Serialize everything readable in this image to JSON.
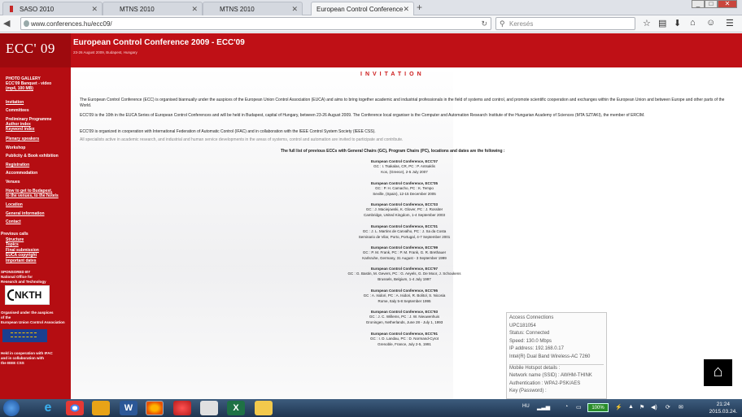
{
  "browser": {
    "tabs": [
      {
        "label": "SASO 2010",
        "active": false
      },
      {
        "label": "MTNS 2010",
        "active": false
      },
      {
        "label": "MTNS 2010",
        "active": false
      },
      {
        "label": "European Control Conference",
        "active": true
      }
    ],
    "url": "www.conferences.hu/ecc09/",
    "search_placeholder": "Keresés",
    "window_buttons": [
      "_",
      "□",
      "✕"
    ]
  },
  "site": {
    "logo": "ECC' 09",
    "title": "European Control Conference 2009 - ECC'09",
    "subtitle": "23-26 August 2009, Budapest, Hungary"
  },
  "sidebar": {
    "items": [
      {
        "label": "PHOTO GALLERY",
        "link": false
      },
      {
        "label": "ECC'09 Banquet - video",
        "link": false
      },
      {
        "label": "(mp4, 100 MB)",
        "link": false
      },
      {
        "label": "Invitation",
        "link": true
      },
      {
        "label": "Committees",
        "link": false
      },
      {
        "label": "Preliminary Programme",
        "link": false
      },
      {
        "label": "Author index",
        "link": true
      },
      {
        "label": "Keyword index",
        "link": true
      },
      {
        "label": "Plenary speakers",
        "link": true
      },
      {
        "label": "Workshop",
        "link": false
      },
      {
        "label": "Publicity & Book exhibition",
        "link": false
      },
      {
        "label": "Registration",
        "link": true
      },
      {
        "label": "Accommodation",
        "link": false
      },
      {
        "label": "Venues",
        "link": false
      },
      {
        "label": "How to get to Budapest,",
        "link": true
      },
      {
        "label": "to the venues, to the hotels",
        "link": true
      },
      {
        "label": "Location",
        "link": true
      },
      {
        "label": "General information",
        "link": true
      },
      {
        "label": "Contact",
        "link": true
      },
      {
        "label": "Previous calls",
        "link": false
      },
      {
        "label": "Structure",
        "link": true
      },
      {
        "label": "Topics",
        "link": true
      },
      {
        "label": "Final submission",
        "link": true
      },
      {
        "label": "EUCA copyright",
        "link": true
      },
      {
        "label": "Important dates",
        "link": true
      }
    ],
    "sponsor_text": [
      "SPONSORED BY",
      "National Office for",
      "Research and Technology"
    ],
    "nkth_logo": "NKTH",
    "organised_text": [
      "Organised under the auspices",
      "of the",
      "European Union Control Association"
    ],
    "held_text": [
      "Held in cooperation with IFAC",
      "and in collaboration with",
      "the IEEE CSS"
    ]
  },
  "main": {
    "heading": "INVITATION",
    "para1": "The European Control Conference (ECC) is organised biannually under the auspices of the European Union Control Association (EUCA) and aims to bring together academic and industrial professionals in the field of systems and control, and promote scientific cooperation and exchanges within the European Union and between Europe and other parts of the World.",
    "para2": "ECC'09 is the 10th in the EUCA Series of European Control Conferences and will be held in Budapest, capital of Hungary, between 23-26 August 2009. The Conference local organiser is the Computer and Automation Research Institute of the Hungarian Academy of Sciences (MTA SZTAKI), the member of ERCIM.",
    "para3": "ECC'09 is organized in cooperation with International Federation of Automatic Control (IFAC) and in collaboration with the IEEE Control System Society (IEEE CSS).",
    "para4": "All specialists active in academic research, and industrial and human service developments in the areas of systems, control and automation are invited to participate and contribute.",
    "full_list": "The full list of previous ECCs with General Chairs (GC), Program Chairs (PC), locations and dates are the following :",
    "previous": [
      {
        "name": "European Control Conference, ECC'07",
        "chairs": "GC : I. Tsakalas, CR, PC : P. Antsaklis",
        "place": "Kos, (Greece), 2-5 July 2007"
      },
      {
        "name": "European Control Conference, ECC'05",
        "chairs": "GC : P. H. Camacho, PC : K. Tempo",
        "place": "Seville, (Spain), 12-15 December 2005"
      },
      {
        "name": "European Control Conference, ECC'03",
        "chairs": "GC : J. Maciejowski, K. Glover, PC : J. Rossiter",
        "place": "Cambridge, United Kingdom, 1-4 September 2003"
      },
      {
        "name": "European Control Conference, ECC'01",
        "chairs": "GC : J. L. Martins de Carvalho, PC : J. Sa da Costa",
        "place": "Seminario de Vilar, Porto, Portugal, 4-7 September 2001"
      },
      {
        "name": "European Control Conference, ECC'99",
        "chairs": "GC : P. M. Frank, PC : P. M. Frank, G. R. Brethauer",
        "place": "Karlsruhe, Germany, 31 August - 3 September 1999"
      },
      {
        "name": "European Control Conference, ECC'97",
        "chairs": "GC : G. Bastin, M. Gevers, PC : G. Aeyels, G. De Moor, J. Schoukens",
        "place": "Brussels, Belgium, 1-4 July 1997"
      },
      {
        "name": "European Control Conference, ECC'95",
        "chairs": "GC : A. Isidori, PC : A. Isidori, R. Bolitol, S. Nicosia",
        "place": "Rome, Italy 5-8 September 1995"
      },
      {
        "name": "European Control Conference, ECC'93",
        "chairs": "GC : J. C. Willems, PC : J. W. Nieuwenhuis",
        "place": "Groningen, Netherlands, June 28 - July 1, 1993"
      },
      {
        "name": "European Control Conference, ECC'91",
        "chairs": "GC : I. D. Landau, PC : D. Normand-Cyrot",
        "place": "Grenoble, France, July 2-5, 1991"
      }
    ]
  },
  "popup": {
    "lines": [
      "Access Connections",
      "UPC181054",
      "Status: Connected",
      "Speed: 130.0 Mbps",
      "IP address: 192.168.0.17",
      "Intel(R) Dual Band Wireless-AC 7260"
    ],
    "lines2": [
      "Mobile Hotspot details :",
      "Network name (SSID) : AWHM-THINK",
      "Authentication : WPA2-PSK/AES",
      "Key (Password) :"
    ]
  },
  "taskbar": {
    "language": "HU",
    "battery": "100%",
    "time": "21:24",
    "date": "2015.03.24."
  }
}
